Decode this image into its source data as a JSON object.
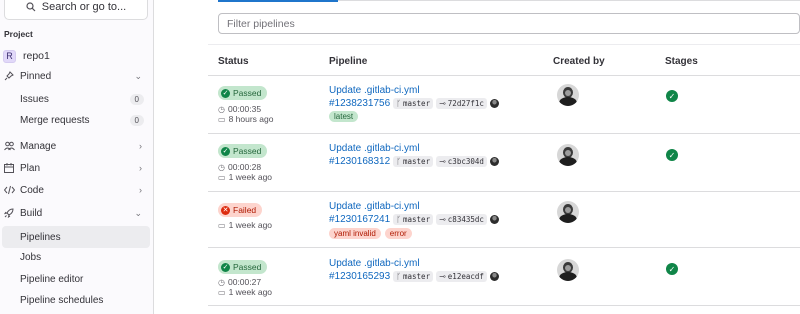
{
  "sidebar": {
    "search_label": "Search or go to...",
    "section_label": "Project",
    "project": {
      "initial": "R",
      "name": "repo1"
    },
    "items": [
      {
        "label": "Pinned",
        "icon": "pin-icon",
        "chevron": "⌄"
      },
      {
        "label": "Issues",
        "badge": "0"
      },
      {
        "label": "Merge requests",
        "badge": "0"
      },
      {
        "label": "Manage",
        "icon": "users-icon",
        "chevron": "›"
      },
      {
        "label": "Plan",
        "icon": "calendar-icon",
        "chevron": "›"
      },
      {
        "label": "Code",
        "icon": "code-icon",
        "chevron": "›"
      },
      {
        "label": "Build",
        "icon": "rocket-icon",
        "chevron": "⌄"
      },
      {
        "label": "Pipelines"
      },
      {
        "label": "Jobs"
      },
      {
        "label": "Pipeline editor"
      },
      {
        "label": "Pipeline schedules"
      }
    ]
  },
  "filter": {
    "placeholder": "Filter pipelines"
  },
  "table": {
    "headers": {
      "status": "Status",
      "pipeline": "Pipeline",
      "created_by": "Created by",
      "stages": "Stages"
    },
    "rows": [
      {
        "status": "Passed",
        "status_type": "passed",
        "duration": "00:00:35",
        "when": "8 hours ago",
        "title": "Update .gitlab-ci.yml",
        "id": "#1238231756",
        "branch": "master",
        "commit": "72d27f1c",
        "tags": [
          "latest"
        ]
      },
      {
        "status": "Passed",
        "status_type": "passed",
        "duration": "00:00:28",
        "when": "1 week ago",
        "title": "Update .gitlab-ci.yml",
        "id": "#1230168312",
        "branch": "master",
        "commit": "c3bc304d",
        "tags": []
      },
      {
        "status": "Failed",
        "status_type": "failed",
        "duration": "",
        "when": "1 week ago",
        "title": "Update .gitlab-ci.yml",
        "id": "#1230167241",
        "branch": "master",
        "commit": "c83435dc",
        "tags": [
          "yaml invalid",
          "error"
        ]
      },
      {
        "status": "Passed",
        "status_type": "passed",
        "duration": "00:00:27",
        "when": "1 week ago",
        "title": "Update .gitlab-ci.yml",
        "id": "#1230165293",
        "branch": "master",
        "commit": "e12eacdf",
        "tags": []
      }
    ]
  },
  "colors": {
    "link": "#1068bf",
    "passed": "#108548",
    "failed": "#dd2b0e"
  }
}
